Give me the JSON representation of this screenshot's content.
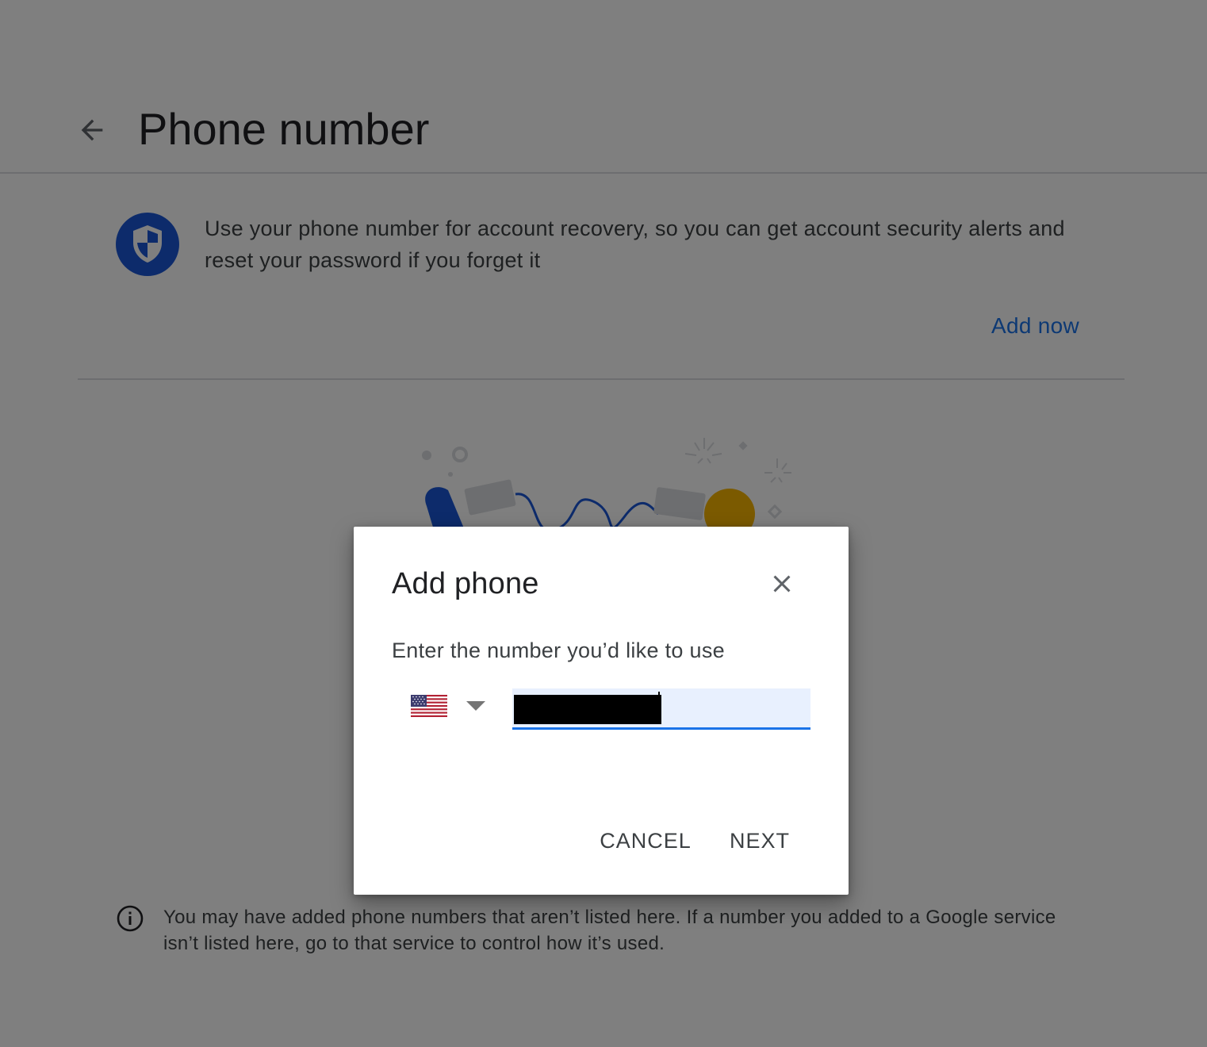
{
  "header": {
    "back_icon": "arrow-back-icon",
    "title": "Phone number"
  },
  "recovery": {
    "icon": "shield-icon",
    "text": "Use your phone number for account recovery, so you can get account security alerts and reset your password if you forget it",
    "action_label": "Add now"
  },
  "info": {
    "icon": "info-icon",
    "text": "You may have added phone numbers that aren’t listed here. If a number you added to a Google service isn’t listed here, go to that service to control how it’s used."
  },
  "dialog": {
    "title": "Add phone",
    "close_icon": "close-icon",
    "prompt": "Enter the number you’d like to use",
    "country_flag_icon": "us-flag-icon",
    "dropdown_icon": "arrow-drop-down-icon",
    "phone_value": "",
    "cancel_label": "CANCEL",
    "next_label": "NEXT"
  },
  "colors": {
    "accent": "#1a73e8",
    "shield": "#1a57d6",
    "yellow": "#f6b400",
    "scrim": "rgba(0,0,0,0.5)"
  }
}
